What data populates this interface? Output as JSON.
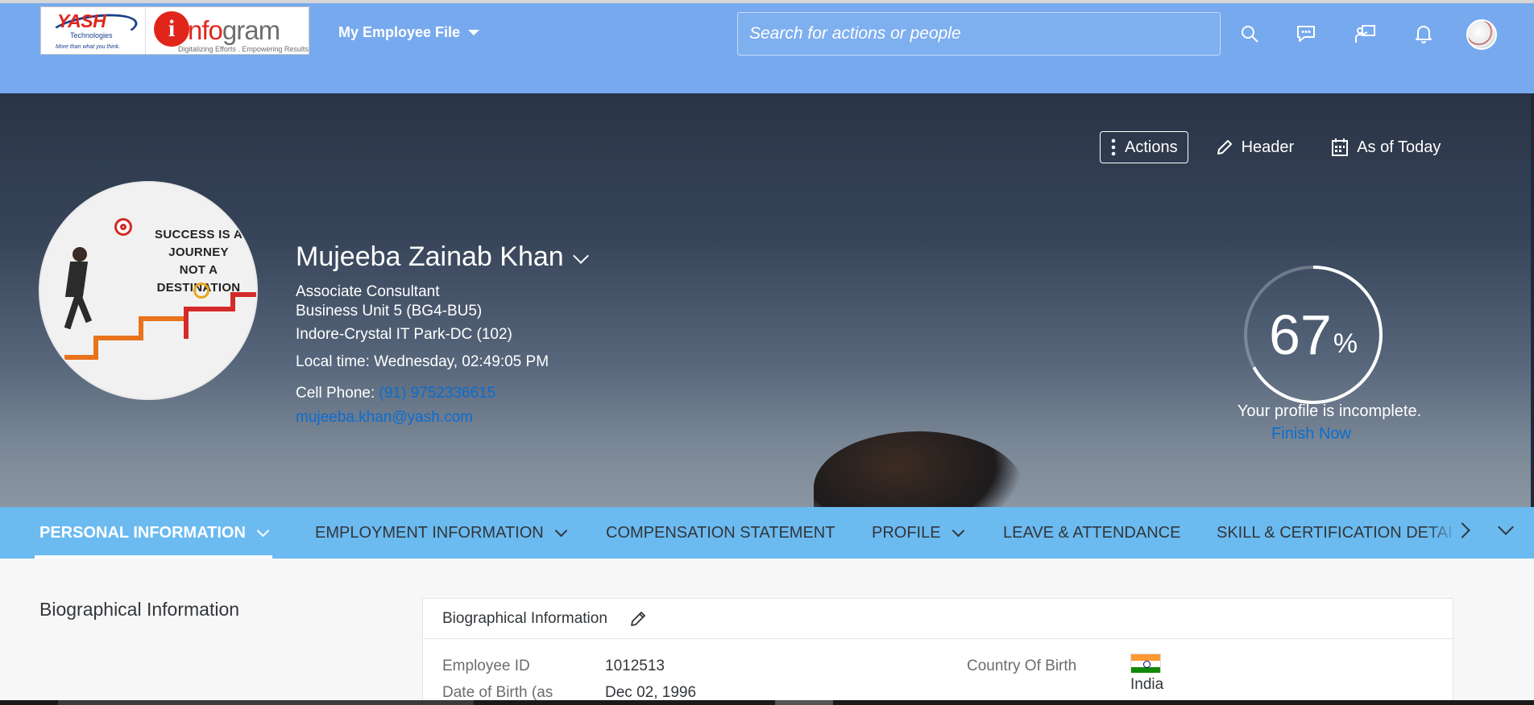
{
  "header": {
    "logo_yash": "YASH",
    "logo_yash_sub": "Technologies",
    "logo_yash_tagline": "More than what you think.",
    "logo_info_prefix": "i",
    "logo_info_accent": "nfo",
    "logo_info_name": "gram",
    "logo_info_tagline": "Digitalizing Efforts . Empowering Results",
    "module_menu_label": "My Employee File",
    "search_placeholder": "Search for actions or people",
    "icons": [
      "search-icon",
      "feedback-icon",
      "presenter-icon",
      "notifications-icon",
      "user-avatar"
    ],
    "colors": {
      "bar": "#77a9ee"
    }
  },
  "hero": {
    "actions": {
      "actions_label": "Actions",
      "header_label": "Header",
      "as_of_label": "As of Today"
    },
    "name": "Mujeeba Zainab Khan",
    "title": "Associate Consultant",
    "business_unit": "Business Unit 5 (BG4-BU5)",
    "location": "Indore-Crystal IT Park-DC (102)",
    "local_time": "Local time: Wednesday, 02:49:05 PM",
    "cell_phone_label": "Cell Phone:",
    "cell_phone": "(91) 9752336615",
    "email": "mujeeba.khan@yash.com",
    "photo_quote": [
      "SUCCESS IS A",
      "JOURNEY",
      "NOT A DESTINATION"
    ],
    "profile_completion": 67,
    "profile_completion_number": "67",
    "profile_completion_unit": "%",
    "profile_status": "Your profile is incomplete.",
    "finish_label": "Finish Now",
    "colors": {
      "link": "#0a6ed1",
      "gauge": "#ffffff"
    }
  },
  "tabs": [
    {
      "label": "PERSONAL INFORMATION",
      "active": true,
      "has_menu": true
    },
    {
      "label": "EMPLOYMENT INFORMATION",
      "active": false,
      "has_menu": true
    },
    {
      "label": "COMPENSATION STATEMENT",
      "active": false,
      "has_menu": false
    },
    {
      "label": "PROFILE",
      "active": false,
      "has_menu": true
    },
    {
      "label": "LEAVE & ATTENDANCE",
      "active": false,
      "has_menu": false
    },
    {
      "label": "SKILL & CERTIFICATION DETAI",
      "active": false,
      "has_menu": false
    }
  ],
  "tab_colors": {
    "bar": "#6bbaf0"
  },
  "content": {
    "section_title": "Biographical Information",
    "card_title": "Biographical Information",
    "fields": [
      {
        "label": "Employee ID",
        "value": "1012513"
      },
      {
        "label": "Date of Birth (as",
        "value": "Dec 02, 1996"
      },
      {
        "label": "Country Of Birth",
        "value": "India"
      }
    ]
  }
}
